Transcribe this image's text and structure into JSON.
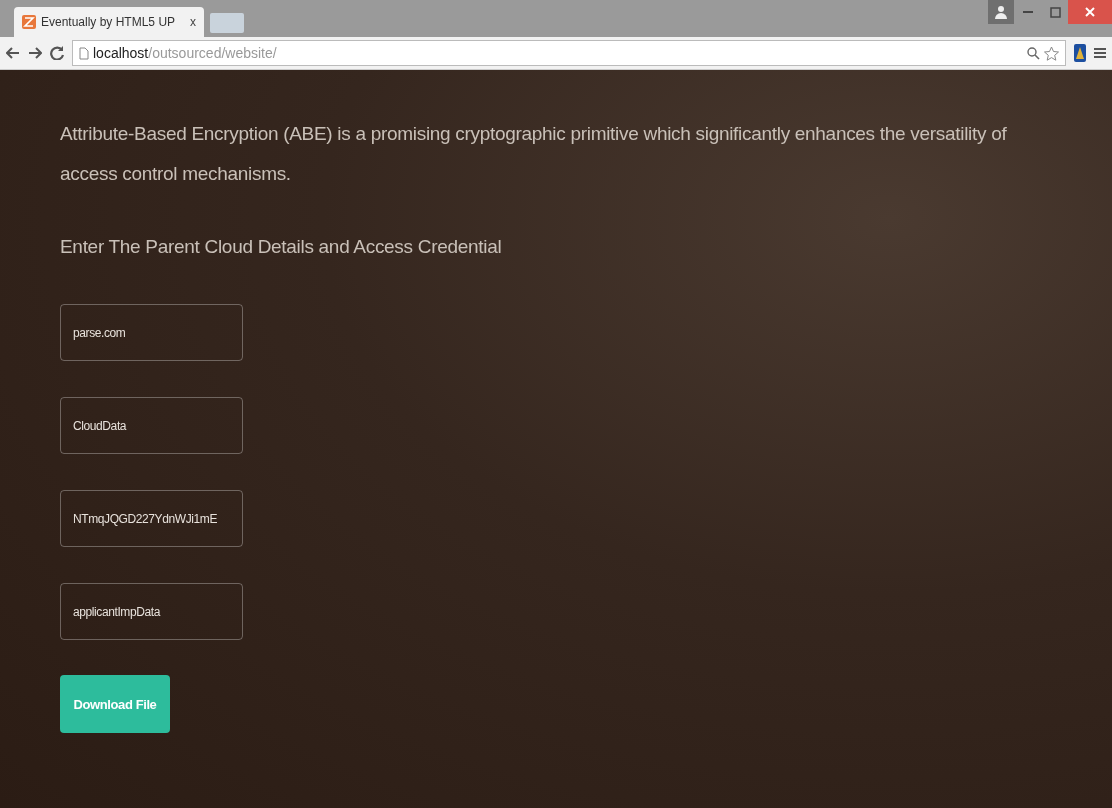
{
  "browser": {
    "tab": {
      "title": "Eventually by HTML5 UP",
      "close": "x"
    },
    "address": {
      "host": "localhost",
      "path": "/outsourced/website/"
    }
  },
  "page": {
    "intro": "Attribute-Based Encryption (ABE) is a promising cryptographic primitive which significantly enhances the versatility of access control mechanisms.",
    "heading": "Enter The Parent Cloud Details and Access Credential",
    "fields": [
      {
        "value": "parse.com"
      },
      {
        "value": "CloudData"
      },
      {
        "value": "NTmqJQGD227YdnWJi1mE"
      },
      {
        "value": "applicantImpData"
      }
    ],
    "button": "Download File"
  }
}
